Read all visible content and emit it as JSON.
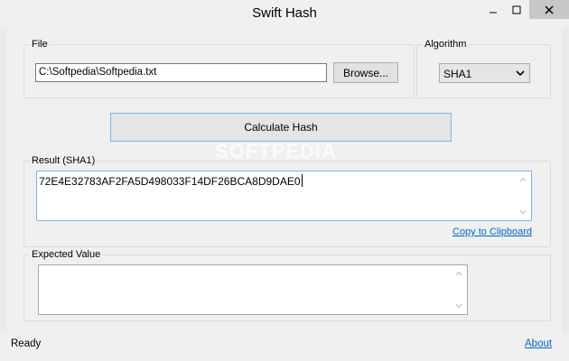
{
  "window": {
    "title": "Swift Hash"
  },
  "file_group": {
    "label": "File",
    "path_value": "C:\\Softpedia\\Softpedia.txt",
    "browse_label": "Browse..."
  },
  "algorithm_group": {
    "label": "Algorithm",
    "selected": "SHA1"
  },
  "calculate_label": "Calculate Hash",
  "watermark": "SOFTPEDIA",
  "result_group": {
    "label": "Result (SHA1)",
    "value": "72E4E32783AF2FA5D498033F14DF26BCA8D9DAE0",
    "copy_link": "Copy to Clipboard"
  },
  "expected_group": {
    "label": "Expected Value",
    "value": ""
  },
  "statusbar": {
    "status": "Ready",
    "about_link": "About"
  },
  "colors": {
    "accent_border": "#7eb4ea",
    "link": "#0066cc",
    "close_button_bg": "#c7c7c7"
  },
  "icons": {
    "minimize": "minimize-icon",
    "maximize": "maximize-icon",
    "close": "close-icon",
    "dropdown": "chevron-down-icon"
  }
}
